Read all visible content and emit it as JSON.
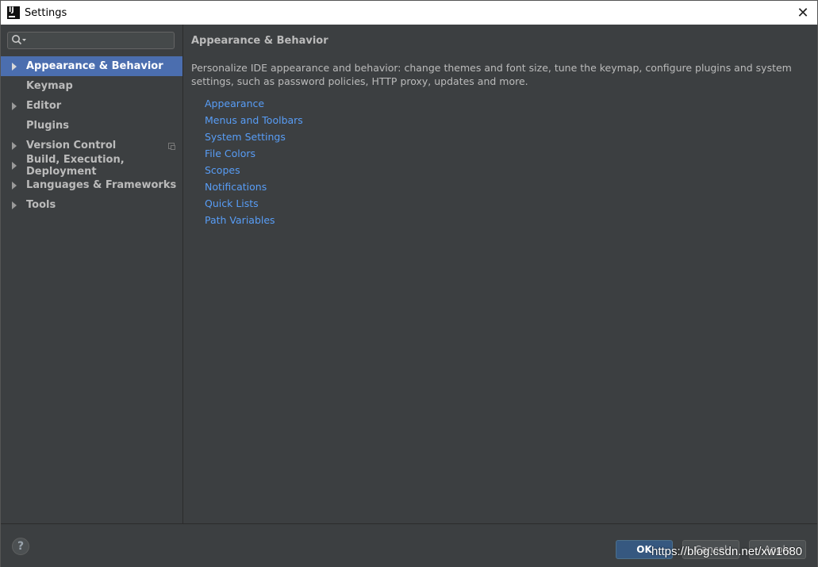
{
  "window": {
    "title": "Settings",
    "close_glyph": "✕"
  },
  "sidebar": {
    "search": {
      "icon": "search-icon",
      "value": "",
      "placeholder": ""
    },
    "items": [
      {
        "label": "Appearance & Behavior",
        "expandable": true,
        "selected": true
      },
      {
        "label": "Keymap",
        "expandable": false,
        "selected": false
      },
      {
        "label": "Editor",
        "expandable": true,
        "selected": false
      },
      {
        "label": "Plugins",
        "expandable": false,
        "selected": false
      },
      {
        "label": "Version Control",
        "expandable": true,
        "selected": false,
        "icon": "project-level-icon"
      },
      {
        "label": "Build, Execution, Deployment",
        "expandable": true,
        "selected": false
      },
      {
        "label": "Languages & Frameworks",
        "expandable": true,
        "selected": false
      },
      {
        "label": "Tools",
        "expandable": true,
        "selected": false
      }
    ]
  },
  "content": {
    "title": "Appearance & Behavior",
    "description": "Personalize IDE appearance and behavior: change themes and font size, tune the keymap, configure plugins and system settings, such as password policies, HTTP proxy, updates and more.",
    "links": [
      "Appearance",
      "Menus and Toolbars",
      "System Settings",
      "File Colors",
      "Scopes",
      "Notifications",
      "Quick Lists",
      "Path Variables"
    ]
  },
  "footer": {
    "help_glyph": "?",
    "ok_label": "OK",
    "cancel_label": "Cancel",
    "apply_label": "Apply",
    "watermark": "https://blog.csdn.net/xw1680"
  },
  "colors": {
    "background": "#3c3f41",
    "selection": "#4b6eaf",
    "link": "#589df6",
    "text": "#bbbbbb",
    "ok_button": "#365880"
  }
}
